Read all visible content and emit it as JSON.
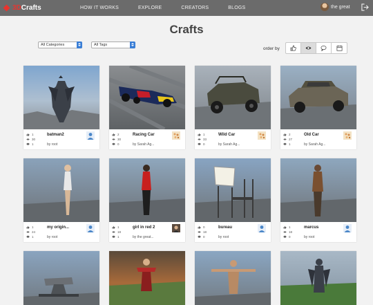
{
  "brand": {
    "logo_prefix": "3D",
    "logo_suffix": "Crafts",
    "accent_color": "#e8342e"
  },
  "nav": {
    "items": [
      {
        "label": "HOW IT WORKS"
      },
      {
        "label": "EXPLORE"
      },
      {
        "label": "CREATORS"
      },
      {
        "label": "BLOGS"
      }
    ]
  },
  "user": {
    "name": "the great",
    "avatar_icon": "user-avatar"
  },
  "page": {
    "title": "Crafts"
  },
  "filters": {
    "category": "All Categories",
    "tags": "All Tags"
  },
  "order": {
    "label": "order by",
    "options": [
      {
        "icon": "thumbs-up-icon"
      },
      {
        "icon": "eye-icon",
        "selected": true
      },
      {
        "icon": "comment-icon"
      },
      {
        "icon": "calendar-icon"
      }
    ]
  },
  "crafts": [
    {
      "title": "batman2",
      "likes": "1",
      "views": "30",
      "comments": "1",
      "author": "by root",
      "avatar": "default"
    },
    {
      "title": "Racing Car",
      "likes": "2",
      "views": "30",
      "comments": "0",
      "author": "by Sarah Ag...",
      "avatar": "sarah"
    },
    {
      "title": "Wild Car",
      "likes": "1",
      "views": "33",
      "comments": "0",
      "author": "by Sarah Ag...",
      "avatar": "sarah"
    },
    {
      "title": "Old Car",
      "likes": "2",
      "views": "27",
      "comments": "1",
      "author": "by Sarah Ag...",
      "avatar": "sarah"
    },
    {
      "title": "my origin...",
      "likes": "1",
      "views": "24",
      "comments": "1",
      "author": "by root",
      "avatar": "default"
    },
    {
      "title": "girl in red 2",
      "likes": "1",
      "views": "18",
      "comments": "1",
      "author": "by the great...",
      "avatar": "photo"
    },
    {
      "title": "bureau",
      "likes": "0",
      "views": "18",
      "comments": "0",
      "author": "by root",
      "avatar": "default"
    },
    {
      "title": "marcus",
      "likes": "1",
      "views": "18",
      "comments": "0",
      "author": "by root",
      "avatar": "default"
    },
    {
      "title": "",
      "likes": "",
      "views": "",
      "comments": "",
      "author": "",
      "avatar": ""
    },
    {
      "title": "",
      "likes": "",
      "views": "",
      "comments": "",
      "author": "",
      "avatar": ""
    },
    {
      "title": "",
      "likes": "",
      "views": "",
      "comments": "",
      "author": "",
      "avatar": ""
    },
    {
      "title": "",
      "likes": "",
      "views": "",
      "comments": "",
      "author": "",
      "avatar": ""
    }
  ]
}
